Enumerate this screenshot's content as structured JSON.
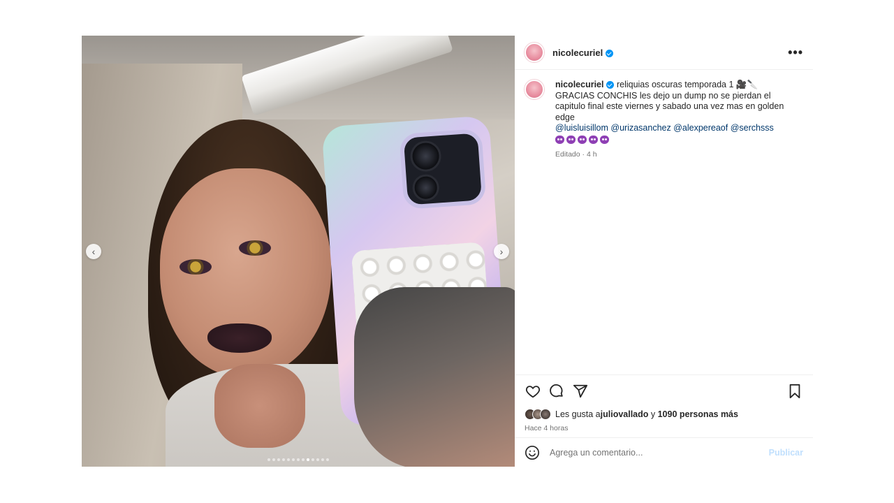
{
  "post": {
    "username": "nicolecuriel",
    "verified": true,
    "more_label": "•••",
    "media": {
      "nav_prev": "‹",
      "nav_next": "›",
      "dot_count": 13,
      "active_dot": 8
    },
    "caption": {
      "username": "nicolecuriel",
      "line1": " reliquias oscuras temporada 1 🎥🔪",
      "line2": "GRACIAS CONCHIS les dejo un dump no se pierdan el capitulo final este viernes y sabado una vez mas en golden edge",
      "mentions": [
        "@luisluisillom",
        "@urizasanchez",
        "@alexpereaof",
        "@serchsss"
      ],
      "emoji_count": 5,
      "meta": "Editado · 4 h"
    },
    "likes": {
      "prefix": "Les gusta a ",
      "user": "juliovallado",
      "middle": " y ",
      "rest": "1090 personas más"
    },
    "time": "Hace 4 horas",
    "comment": {
      "placeholder": "Agrega un comentario...",
      "publish": "Publicar"
    }
  },
  "icons": {
    "like": "heart-icon",
    "comment": "comment-icon",
    "share": "send-icon",
    "save": "bookmark-icon",
    "emoji": "smiley-icon"
  },
  "colors": {
    "verified": "#0095f6",
    "mention": "#00376b",
    "muted": "#737373",
    "publish_disabled": "#c0dffd"
  }
}
